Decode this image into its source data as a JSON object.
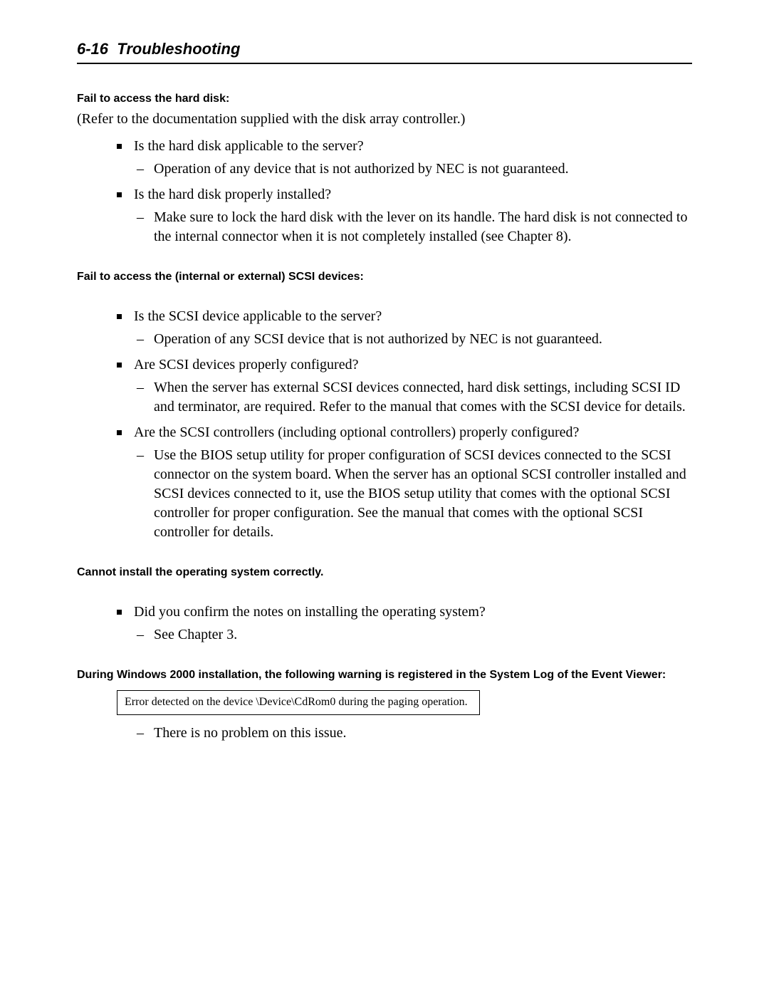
{
  "header": {
    "page_number": "6-16",
    "title": "Troubleshooting"
  },
  "sections": {
    "s1": {
      "heading": "Fail to access the hard disk:",
      "intro": "(Refer to the documentation supplied with the disk array controller.)",
      "b1": {
        "q": "Is the hard disk applicable to the server?",
        "d": "Operation of any device that is not authorized by NEC is not guaranteed."
      },
      "b2": {
        "q": "Is the hard disk properly installed?",
        "d": "Make sure to lock the hard disk with the lever on its handle.  The hard disk is not connected to the internal connector when it is not completely installed (see Chapter 8)."
      }
    },
    "s2": {
      "heading": "Fail to access the (internal or external) SCSI devices:",
      "b1": {
        "q": "Is the SCSI device applicable to the server?",
        "d": "Operation of any SCSI device that is not authorized by NEC is not guaranteed."
      },
      "b2": {
        "q": "Are SCSI devices properly configured?",
        "d": "When the server has external SCSI devices connected, hard disk settings, including SCSI ID and terminator, are required.  Refer to the manual that comes with the SCSI device for details."
      },
      "b3": {
        "q": "Are the SCSI controllers (including optional controllers) properly configured?",
        "d": "Use the BIOS setup utility for proper configuration of SCSI devices connected to the SCSI connector on the system board.  When the server has an optional SCSI controller installed and SCSI devices connected to it, use the BIOS setup utility that comes with the optional SCSI controller for proper configuration.  See the manual that comes with the optional SCSI controller for details."
      }
    },
    "s3": {
      "heading": "Cannot install the operating system correctly.",
      "b1": {
        "q": "Did you confirm the notes on installing the operating system?",
        "d": "See Chapter 3."
      }
    },
    "s4": {
      "heading": "During Windows 2000 installation, the following warning is registered in the System Log of the Event Viewer:",
      "errorbox": "Error detected on the device \\Device\\CdRom0 during the paging operation.",
      "note": "There is no problem on this issue."
    }
  }
}
